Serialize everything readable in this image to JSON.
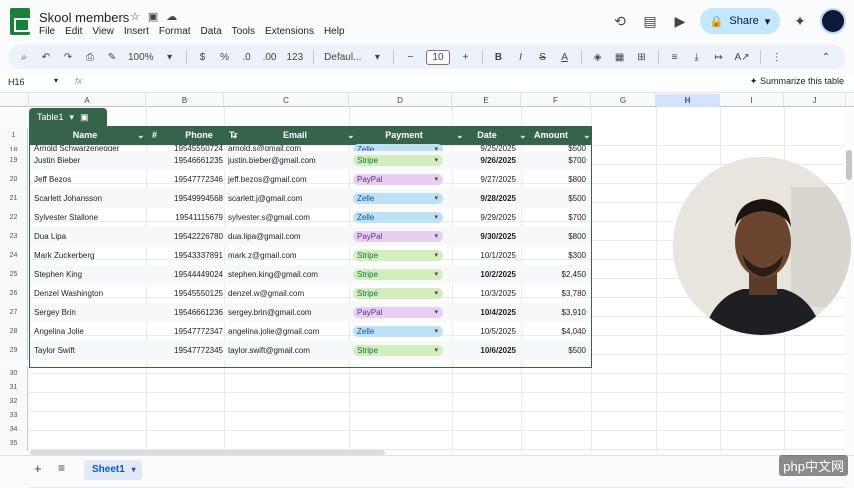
{
  "doc_title": "Skool members",
  "menu": [
    "File",
    "Edit",
    "View",
    "Insert",
    "Format",
    "Data",
    "Tools",
    "Extensions",
    "Help"
  ],
  "share_label": "Share",
  "toolbar": {
    "zoom": "100%",
    "currency": "$",
    "percent": "%",
    "number_format": "123",
    "font": "Defaul...",
    "font_size": "10"
  },
  "formula_bar": {
    "cell_ref": "H16",
    "fx": "fx",
    "summarize": "Summarize this table"
  },
  "column_letters": [
    "A",
    "B",
    "C",
    "D",
    "E",
    "F",
    "G",
    "H",
    "I",
    "J"
  ],
  "table_name": "Table1",
  "table_headers": [
    "Name",
    "#",
    "Phone",
    "Tr",
    "Email",
    "Payment",
    "Date",
    "Amount"
  ],
  "rows": [
    {
      "num": "18",
      "name": "Arnold Schwarzenegger",
      "phone": "19545550724",
      "email": "arnold.s@gmail.com",
      "payment": "Zelle",
      "date": "9/25/2025",
      "amount": "$500",
      "bold": false
    },
    {
      "num": "19",
      "name": "Justin Bieber",
      "phone": "19546661235",
      "email": "justin.bieber@gmail.com",
      "payment": "Stripe",
      "date": "9/26/2025",
      "amount": "$700",
      "bold": true
    },
    {
      "num": "20",
      "name": "Jeff Bezos",
      "phone": "19547772346",
      "email": "jeff.bezos@gmail.com",
      "payment": "PayPal",
      "date": "9/27/2025",
      "amount": "$800",
      "bold": false
    },
    {
      "num": "21",
      "name": "Scarlett Johansson",
      "phone": "19549994568",
      "email": "scarlett.j@gmail.com",
      "payment": "Zelle",
      "date": "9/28/2025",
      "amount": "$500",
      "bold": true
    },
    {
      "num": "22",
      "name": "Sylvester Stallone",
      "phone": "19541115679",
      "email": "sylvester.s@gmail.com",
      "payment": "Zelle",
      "date": "9/29/2025",
      "amount": "$700",
      "bold": false
    },
    {
      "num": "23",
      "name": "Dua Lipa",
      "phone": "19542226780",
      "email": "dua.lipa@gmail.com",
      "payment": "PayPal",
      "date": "9/30/2025",
      "amount": "$800",
      "bold": true
    },
    {
      "num": "24",
      "name": "Mark Zuckerberg",
      "phone": "19543337891",
      "email": "mark.z@gmail.com",
      "payment": "Stripe",
      "date": "10/1/2025",
      "amount": "$300",
      "bold": false
    },
    {
      "num": "25",
      "name": "Stephen King",
      "phone": "19544449024",
      "email": "stephen.king@gmail.com",
      "payment": "Stripe",
      "date": "10/2/2025",
      "amount": "$2,450",
      "bold": true
    },
    {
      "num": "26",
      "name": "Denzel Washington",
      "phone": "19545550125",
      "email": "denzel.w@gmail.com",
      "payment": "Stripe",
      "date": "10/3/2025",
      "amount": "$3,780",
      "bold": false
    },
    {
      "num": "27",
      "name": "Sergey Brin",
      "phone": "19546661236",
      "email": "sergey.brin@gmail.com",
      "payment": "PayPal",
      "date": "10/4/2025",
      "amount": "$3,910",
      "bold": true
    },
    {
      "num": "28",
      "name": "Angelina Jolie",
      "phone": "19547772347",
      "email": "angelina.jolie@gmail.com",
      "payment": "Zelle",
      "date": "10/5/2025",
      "amount": "$4,040",
      "bold": false
    },
    {
      "num": "29",
      "name": "Taylor Swift",
      "phone": "19547772345",
      "email": "taylor.swift@gmail.com",
      "payment": "Stripe",
      "date": "10/6/2025",
      "amount": "$500",
      "bold": true
    }
  ],
  "empty_rows": [
    "30",
    "31",
    "32",
    "33",
    "34",
    "35"
  ],
  "payment_colors": {
    "Zelle": "#bfe1f6",
    "Stripe": "#d4edbc",
    "PayPal": "#e6cff2"
  },
  "payment_text_colors": {
    "Zelle": "#0a53a8",
    "Stripe": "#11734b",
    "PayPal": "#5a3286"
  },
  "sheet_tab": "Sheet1",
  "watermark": "php中文网"
}
